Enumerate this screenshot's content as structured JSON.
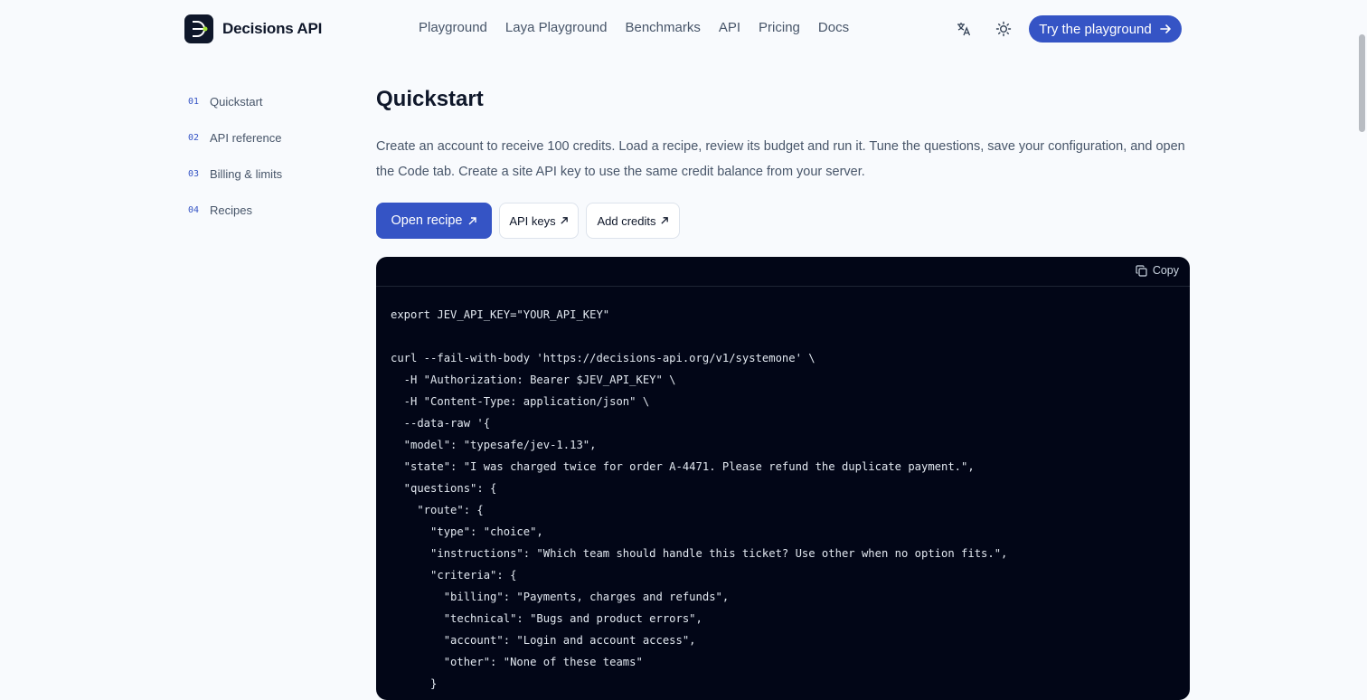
{
  "header": {
    "brand": "Decisions API",
    "nav": [
      "Playground",
      "Laya Playground",
      "Benchmarks",
      "API",
      "Pricing",
      "Docs"
    ],
    "translate_icon": "translate-icon",
    "theme_icon": "sun-icon",
    "cta_label": "Try the playground",
    "cta_icon": "arrow-right-icon"
  },
  "sidebar": {
    "items": [
      {
        "num": "01",
        "label": "Quickstart"
      },
      {
        "num": "02",
        "label": "API reference"
      },
      {
        "num": "03",
        "label": "Billing & limits"
      },
      {
        "num": "04",
        "label": "Recipes"
      }
    ]
  },
  "main": {
    "title": "Quickstart",
    "lead": "Create an account to receive 100 credits. Load a recipe, review its budget and run it. Tune the questions, save your configuration, and open the Code tab. Create a site API key to use the same credit balance from your server.",
    "buttons": {
      "open_recipe": "Open recipe",
      "api_keys": "API keys",
      "add_credits": "Add credits"
    },
    "code": {
      "copy_label": "Copy",
      "text": "export JEV_API_KEY=\"YOUR_API_KEY\"\n\ncurl --fail-with-body 'https://decisions-api.org/v1/systemone' \\\n  -H \"Authorization: Bearer $JEV_API_KEY\" \\\n  -H \"Content-Type: application/json\" \\\n  --data-raw '{\n  \"model\": \"typesafe/jev-1.13\",\n  \"state\": \"I was charged twice for order A-4471. Please refund the duplicate payment.\",\n  \"questions\": {\n    \"route\": {\n      \"type\": \"choice\",\n      \"instructions\": \"Which team should handle this ticket? Use other when no option fits.\",\n      \"criteria\": {\n        \"billing\": \"Payments, charges and refunds\",\n        \"technical\": \"Bugs and product errors\",\n        \"account\": \"Login and account access\",\n        \"other\": \"None of these teams\"\n      }"
    }
  },
  "colors": {
    "accent": "#3554c5",
    "background": "#f8fafd",
    "code_bg": "#020617"
  }
}
